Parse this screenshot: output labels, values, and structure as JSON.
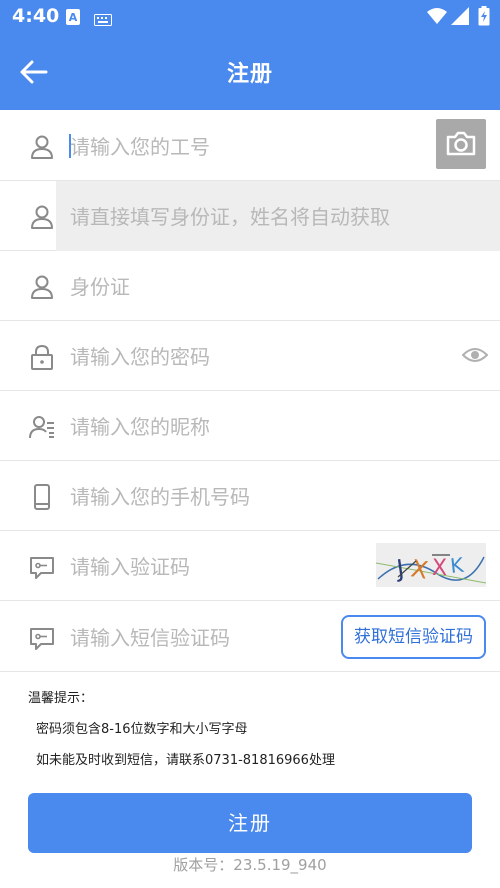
{
  "status_bar": {
    "time": "4:40"
  },
  "header": {
    "title": "注册"
  },
  "form": {
    "employee_id_placeholder": "请输入您的工号",
    "id_card_fill_placeholder": "请直接填写身份证，姓名将自动获取",
    "id_card_placeholder": "身份证",
    "password_placeholder": "请输入您的密码",
    "nickname_placeholder": "请输入您的昵称",
    "phone_placeholder": "请输入您的手机号码",
    "captcha_placeholder": "请输入验证码",
    "captcha_text": "JXXK",
    "sms_placeholder": "请输入短信验证码",
    "sms_button_label": "获取短信验证码"
  },
  "tips": {
    "heading": "温馨提示：",
    "line1": "密码须包含8-16位数字和大小写字母",
    "line2": "如未能及时收到短信，请联系0731-81816966处理"
  },
  "submit_label": "注册",
  "version_text": "版本号：23.5.19_940",
  "colors": {
    "primary": "#4a89ee",
    "placeholder": "#b8b8b8",
    "disabled_field": "#eeeeee"
  }
}
